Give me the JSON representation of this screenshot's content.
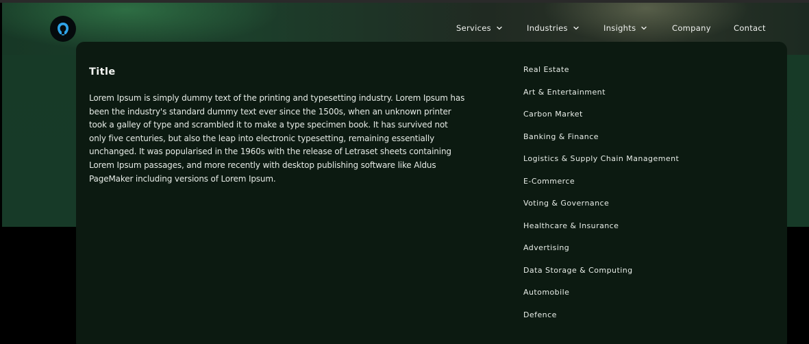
{
  "header": {
    "logo_icon": "brand-logo-icon",
    "accent_color": "#2fa3e8",
    "nav": [
      {
        "label": "Services",
        "has_dropdown": true
      },
      {
        "label": "Industries",
        "has_dropdown": true
      },
      {
        "label": "Insights",
        "has_dropdown": true
      },
      {
        "label": "Company",
        "has_dropdown": false
      },
      {
        "label": "Contact",
        "has_dropdown": false
      }
    ]
  },
  "menu": {
    "title": "Title",
    "description": "Lorem Ipsum is simply dummy text of the printing and typesetting industry. Lorem Ipsum has been the industry's standard dummy text ever since the 1500s, when an unknown printer took a galley of type and scrambled it to make a type specimen book. It has survived not only five centuries, but also the leap into electronic typesetting, remaining essentially unchanged. It was popularised in the 1960s with the release of Letraset sheets containing Lorem Ipsum passages, and more recently with desktop publishing software like Aldus PageMaker including versions of Lorem Ipsum.",
    "industries": [
      "Real Estate",
      "Art & Entertainment",
      "Carbon Market",
      "Banking & Finance",
      "Logistics & Supply Chain Management",
      "E-Commerce",
      "Voting & Governance",
      "Healthcare & Insurance",
      "Advertising",
      "Data Storage & Computing",
      "Automobile",
      "Defence"
    ]
  }
}
